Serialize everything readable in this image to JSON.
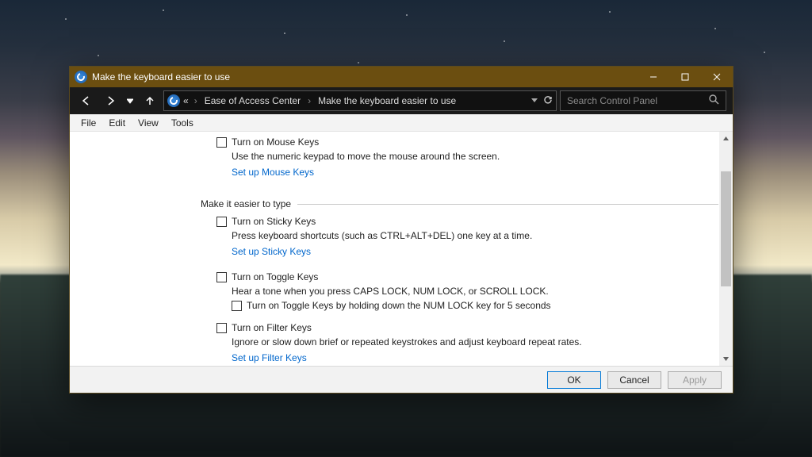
{
  "title": "Make the keyboard easier to use",
  "breadcrumb": {
    "back_prefix": "«",
    "parent": "Ease of Access Center",
    "current": "Make the keyboard easier to use"
  },
  "search": {
    "placeholder": "Search Control Panel"
  },
  "menu": {
    "file": "File",
    "edit": "Edit",
    "view": "View",
    "tools": "Tools"
  },
  "sections": {
    "mouse_keys": {
      "checkbox": "Turn on Mouse Keys",
      "desc": "Use the numeric keypad to move the mouse around the screen.",
      "link": "Set up Mouse Keys"
    },
    "type_group": "Make it easier to type",
    "sticky_keys": {
      "checkbox": "Turn on Sticky Keys",
      "desc": "Press keyboard shortcuts (such as CTRL+ALT+DEL) one key at a time.",
      "link": "Set up Sticky Keys"
    },
    "toggle_keys": {
      "checkbox": "Turn on Toggle Keys",
      "desc": "Hear a tone when you press CAPS LOCK, NUM LOCK, or SCROLL LOCK.",
      "nested": "Turn on Toggle Keys by holding down the NUM LOCK key for 5 seconds"
    },
    "filter_keys": {
      "checkbox": "Turn on Filter Keys",
      "desc": "Ignore or slow down brief or repeated keystrokes and adjust keyboard repeat rates.",
      "link": "Set up Filter Keys"
    }
  },
  "buttons": {
    "ok": "OK",
    "cancel": "Cancel",
    "apply": "Apply"
  }
}
